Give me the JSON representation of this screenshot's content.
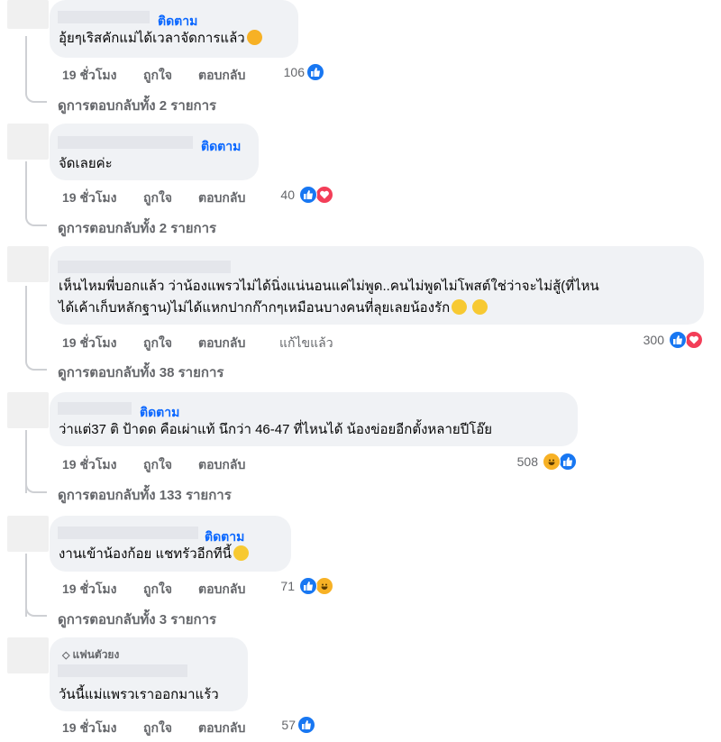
{
  "comments": [
    {
      "follow": "ติดตาม",
      "text": "อุ้ยๆเริสคักแม่ได้เวลาจัดการแล้ว",
      "text_emoji": "rofl-emoji",
      "time": "19 ชั่วโมง",
      "like": "ถูกใจ",
      "reply": "ตอบกลับ",
      "reactions": "106",
      "reaction_icons": [
        "like-icon"
      ],
      "view_replies": "ดูการตอบกลับทั้ง 2 รายการ"
    },
    {
      "follow": "ติดตาม",
      "text": "จัดเลยค่ะ",
      "time": "19 ชั่วโมง",
      "like": "ถูกใจ",
      "reply": "ตอบกลับ",
      "reactions": "40",
      "reaction_icons": [
        "like-icon",
        "love-icon"
      ],
      "view_replies": "ดูการตอบกลับทั้ง 2 รายการ"
    },
    {
      "text_line1": "เห็นไหมพี่บอกแล้ว ว่าน้องแพรวไม่ได้นิ่งแน่นอนแค่ไม่พูด..คนไม่พูดไม่โพสต์ใช่ว่าจะไม่สู้(ที่ไหน",
      "text_line2": "ได้เค้าเก็บหลักฐาน)ไม่ได้แหกปากก๊ากๆเหมือนบางคนที่ลุยเลยน้องรัก",
      "text_emoji": "smirk-emoji",
      "time": "19 ชั่วโมง",
      "like": "ถูกใจ",
      "reply": "ตอบกลับ",
      "edited": "แก้ไขแล้ว",
      "reactions": "300",
      "reaction_icons": [
        "like-icon",
        "love-icon"
      ],
      "view_replies": "ดูการตอบกลับทั้ง 38 รายการ"
    },
    {
      "follow": "ติดตาม",
      "text": "ว่าแต่37 ติ ป้าดด คือเผ่าแท้ นึกว่า 46-47 ที่ไหนได้ น้องข่อยอีกตั้งหลายปีโอ๊ย",
      "time": "19 ชั่วโมง",
      "like": "ถูกใจ",
      "reply": "ตอบกลับ",
      "reactions": "508",
      "reaction_icons": [
        "haha-icon",
        "like-icon"
      ],
      "view_replies": "ดูการตอบกลับทั้ง 133 รายการ"
    },
    {
      "follow": "ติดตาม",
      "text": "งานเข้าน้องก้อย แชทรัวอีกทีนี้",
      "text_emoji": "grin-emoji",
      "time": "19 ชั่วโมง",
      "like": "ถูกใจ",
      "reply": "ตอบกลับ",
      "reactions": "71",
      "reaction_icons": [
        "like-icon",
        "haha-icon"
      ],
      "view_replies": "ดูการตอบกลับทั้ง 3 รายการ"
    },
    {
      "badge": "แฟนตัวยง",
      "badge_icon": "diamond-icon",
      "text": "วันนี้แม่แพรวเราออกมาแร้ว",
      "time": "19 ชั่วโมง",
      "like": "ถูกใจ",
      "reply": "ตอบกลับ",
      "reactions": "57",
      "reaction_icons": [
        "like-icon"
      ]
    }
  ],
  "colors": {
    "link": "#0866ff",
    "meta": "#65676b",
    "bubble": "#f0f2f5",
    "like": "#1877f2",
    "love": "#f33e58",
    "haha": "#f7b125"
  }
}
